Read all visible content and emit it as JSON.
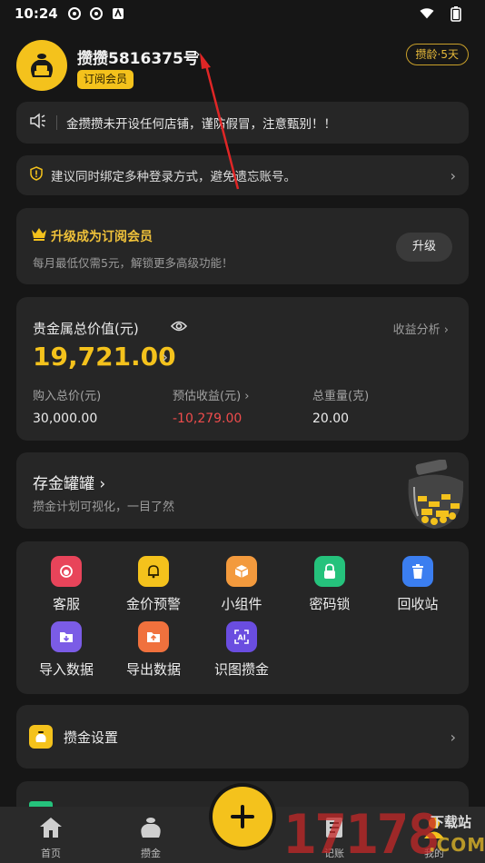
{
  "status_bar": {
    "time": "10:24"
  },
  "header": {
    "username": "攒攒5816375号",
    "username_chevron": "›",
    "member_badge": "订阅会员",
    "age_badge": "攒龄·5天"
  },
  "notice": {
    "text": "金攒攒未开设任何店铺，谨防假冒，注意甄别！！"
  },
  "bind_tip": {
    "text": "建议同时绑定多种登录方式，避免遗忘账号。"
  },
  "upgrade": {
    "title": "升级成为订阅会员",
    "subtitle": "每月最低仅需5元，解锁更多高级功能！",
    "button": "升级"
  },
  "assets": {
    "label": "贵金属总价值(元)",
    "analysis": "收益分析 ›",
    "total": "19,721.00",
    "columns": [
      {
        "key": "购入总价(元)",
        "value": "30,000.00"
      },
      {
        "key": "预估收益(元) ›",
        "value": "-10,279.00"
      },
      {
        "key": "总重量(克)",
        "value": "20.00"
      }
    ]
  },
  "piggy_bank": {
    "title": "存金罐罐 ›",
    "subtitle": "攒金计划可视化，一目了然"
  },
  "tools": [
    {
      "name": "客服",
      "color": "#e8445a",
      "icon": "customer-service-icon"
    },
    {
      "name": "金价预警",
      "color": "#f4c21c",
      "icon": "bell-icon"
    },
    {
      "name": "小组件",
      "color": "#f39a3d",
      "icon": "widget-box-icon"
    },
    {
      "name": "密码锁",
      "color": "#25c27c",
      "icon": "lock-icon"
    },
    {
      "name": "回收站",
      "color": "#3b7ef0",
      "icon": "trash-icon"
    },
    {
      "name": "导入数据",
      "color": "#7b5ce6",
      "icon": "import-icon"
    },
    {
      "name": "导出数据",
      "color": "#f0713d",
      "icon": "export-icon"
    },
    {
      "name": "识图攒金",
      "color": "#6a4de0",
      "icon": "ai-scan-icon"
    }
  ],
  "settings": {
    "label": "攒金设置"
  },
  "bottom_nav": [
    {
      "label": "首页",
      "icon": "home-icon"
    },
    {
      "label": "攒金",
      "icon": "money-bag-icon"
    },
    {
      "label": "记账",
      "icon": "ledger-icon"
    },
    {
      "label": "我的",
      "icon": "profile-icon"
    }
  ],
  "watermark": {
    "numbers": "17178",
    "site": "下载站",
    "domain": ".COM"
  },
  "colors": {
    "accent": "#f4c21c",
    "negative": "#ef4c4c",
    "card": "#262626",
    "background": "#161616"
  }
}
